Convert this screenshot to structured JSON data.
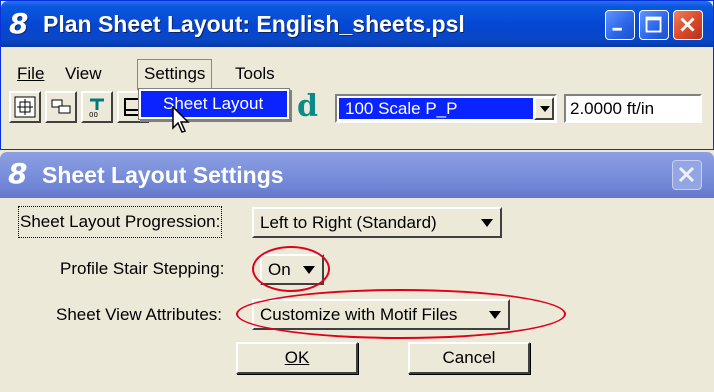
{
  "window_main": {
    "title": "Plan Sheet Layout: English_sheets.psl",
    "logo_glyph": "8",
    "controls": [
      "minimize-icon",
      "maximize-icon",
      "close-icon"
    ]
  },
  "menubar": {
    "items": [
      {
        "label": "File"
      },
      {
        "label": "View"
      },
      {
        "label": "Settings"
      },
      {
        "label": "Tools"
      }
    ]
  },
  "settings_menu": {
    "items": [
      {
        "label": "Sheet Layout"
      }
    ]
  },
  "toolbar": {
    "tools": [
      "place-sheet-icon",
      "sheet-group-icon",
      "sheet-text-icon",
      "sheet-frame-icon",
      "id-tool-icon"
    ],
    "id_glyph": "d",
    "scale": {
      "value": "100 Scale P_P"
    },
    "ft_per_in": {
      "value": "2.0000 ft/in"
    }
  },
  "dialog": {
    "title": "Sheet Layout Settings",
    "logo_glyph": "8",
    "progression": {
      "label": "Sheet Layout Progression:",
      "value": "Left to Right (Standard)"
    },
    "stair": {
      "label": "Profile Stair Stepping:",
      "value": "On"
    },
    "view_attrs": {
      "label": "Sheet View Attributes:",
      "value": "Customize with Motif Files"
    },
    "ok_label": "OK",
    "cancel_label": "Cancel"
  },
  "annotations": {
    "color": "#e0001a",
    "highlighted": [
      "stair-stepping-option",
      "view-attributes-option"
    ]
  }
}
